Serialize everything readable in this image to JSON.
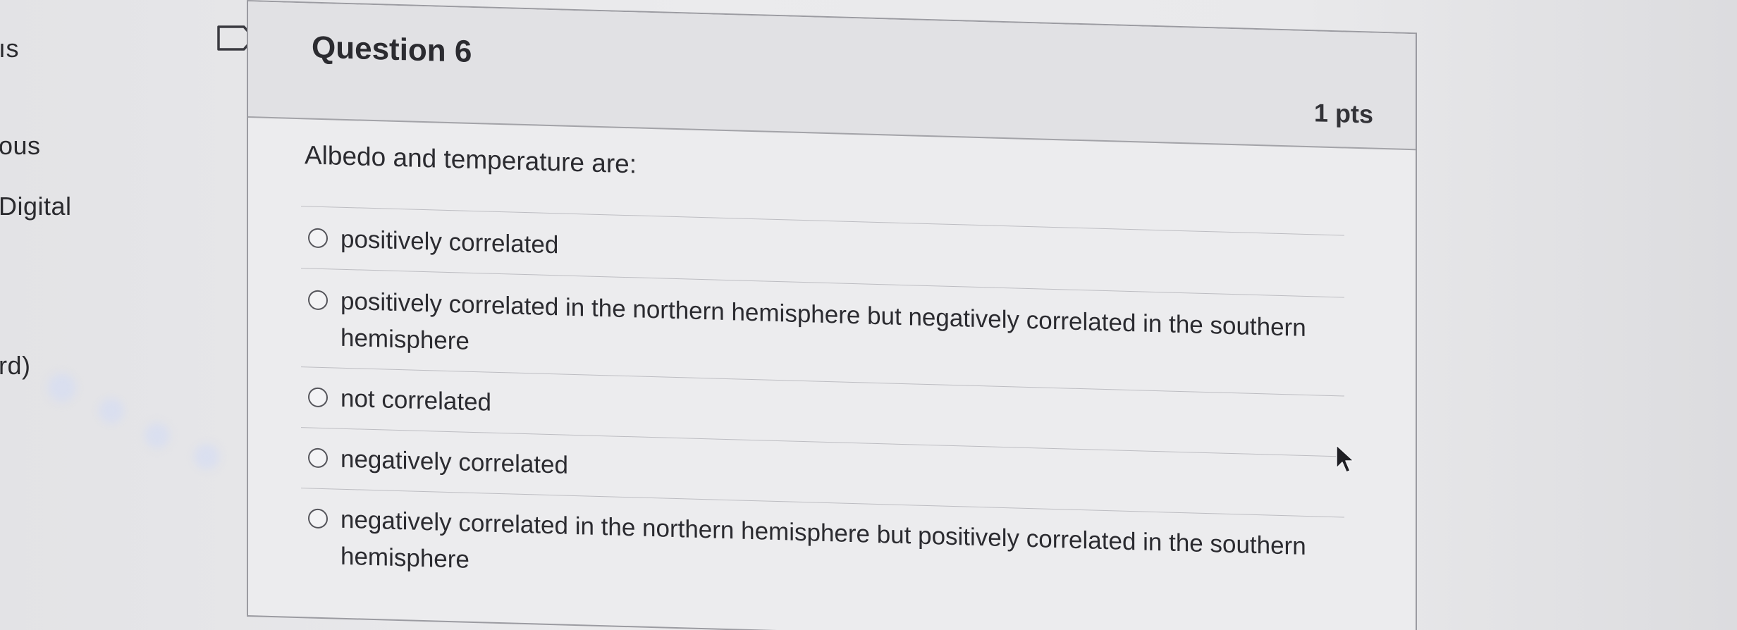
{
  "sidebar": {
    "fragments": [
      "ıs",
      "ous",
      "Digital",
      "rd)"
    ]
  },
  "question": {
    "title": "Question 6",
    "points": "1 pts",
    "text": "Albedo and temperature are:",
    "answers": [
      "positively correlated",
      "positively correlated in the northern hemisphere but negatively correlated in the southern hemisphere",
      "not correlated",
      "negatively correlated",
      "negatively correlated in the northern hemisphere but positively correlated in the southern hemisphere"
    ]
  },
  "icons": {
    "bookmark": "bookmark-flag-icon",
    "cursor": "mouse-pointer-icon",
    "radio": "radio-unselected-icon"
  },
  "colors": {
    "background": "#e7e7e9",
    "card": "#ececee",
    "header": "#e1e1e4",
    "border": "#9b9ba1",
    "text": "#2b2b30"
  }
}
